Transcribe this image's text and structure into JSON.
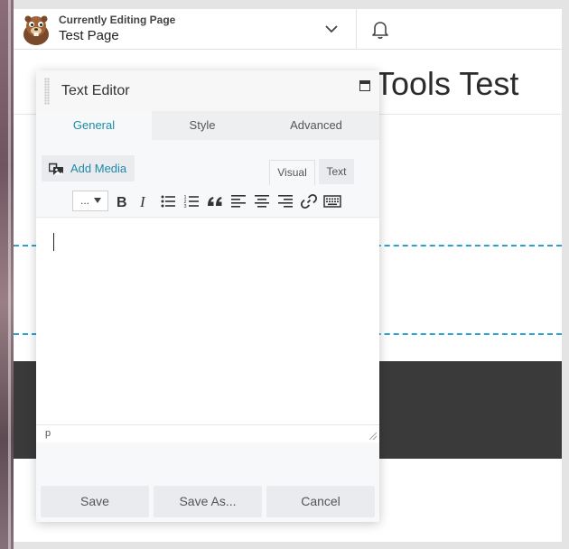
{
  "topbar": {
    "editing_label": "Currently Editing Page",
    "page_name": "Test Page",
    "logo_icon": "beaver-logo-icon",
    "chevron_icon": "chevron-down-icon",
    "bell_icon": "bell-icon"
  },
  "page": {
    "heading": "Tools Test"
  },
  "panel": {
    "title": "Text Editor",
    "tabs": [
      {
        "label": "General",
        "active": true
      },
      {
        "label": "Style",
        "active": false
      },
      {
        "label": "Advanced",
        "active": false
      }
    ],
    "add_media_label": "Add Media",
    "editor_modes": {
      "visual": "Visual",
      "text": "Text"
    },
    "format_select_value": "...",
    "toolbar_icons": [
      "bold-icon",
      "italic-icon",
      "bulleted-list-icon",
      "numbered-list-icon",
      "blockquote-icon",
      "align-left-icon",
      "align-center-icon",
      "align-right-icon",
      "link-icon",
      "keyboard-icon"
    ],
    "path": "p",
    "buttons": {
      "save": "Save",
      "save_as": "Save As...",
      "cancel": "Cancel"
    }
  },
  "colors": {
    "accent": "#1f8aa8",
    "dashed_line": "#2aa3d0",
    "dark_band": "#3a3a3a"
  }
}
